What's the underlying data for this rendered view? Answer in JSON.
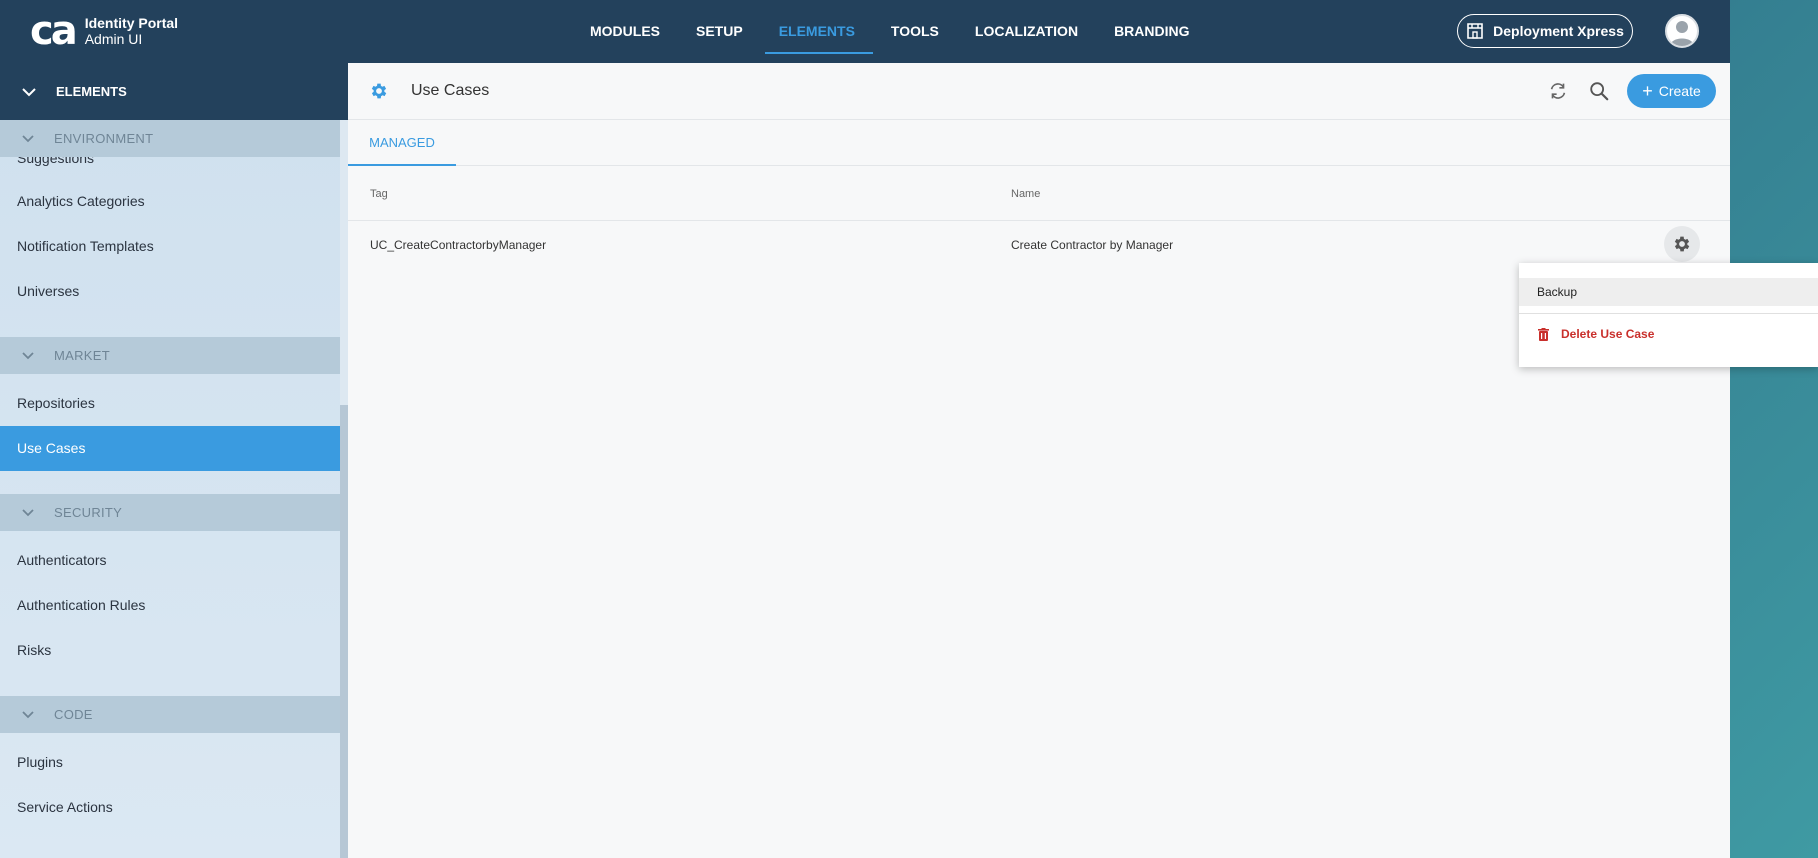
{
  "brand": {
    "mark": "ca",
    "title": "Identity Portal",
    "subtitle": "Admin UI"
  },
  "nav": [
    {
      "label": "MODULES"
    },
    {
      "label": "SETUP"
    },
    {
      "label": "ELEMENTS"
    },
    {
      "label": "TOOLS"
    },
    {
      "label": "LOCALIZATION"
    },
    {
      "label": "BRANDING"
    }
  ],
  "nav_active": "ELEMENTS",
  "deploy_button": "Deployment Xpress",
  "sidebar": {
    "header": "ELEMENTS",
    "environment": {
      "title": "ENVIRONMENT",
      "items": [
        "Suggestions",
        "Analytics Categories",
        "Notification Templates",
        "Universes"
      ]
    },
    "market": {
      "title": "MARKET",
      "items": [
        "Repositories",
        "Use Cases"
      ]
    },
    "security": {
      "title": "SECURITY",
      "items": [
        "Authenticators",
        "Authentication Rules",
        "Risks"
      ]
    },
    "code": {
      "title": "CODE",
      "items": [
        "Plugins",
        "Service Actions"
      ]
    },
    "active_item": "Use Cases"
  },
  "main": {
    "title": "Use Cases",
    "create_label": "Create",
    "tab": "MANAGED",
    "columns": {
      "tag": "Tag",
      "name": "Name"
    },
    "rows": [
      {
        "tag": "UC_CreateContractorbyManager",
        "name": "Create Contractor by Manager"
      }
    ]
  },
  "row_menu": {
    "backup": "Backup",
    "delete": "Delete Use Case"
  },
  "colors": {
    "header": "#23415c",
    "accent": "#3a9be0",
    "danger": "#c9302c",
    "sidebar": "#d4e4f0",
    "section": "#b5cad9"
  }
}
